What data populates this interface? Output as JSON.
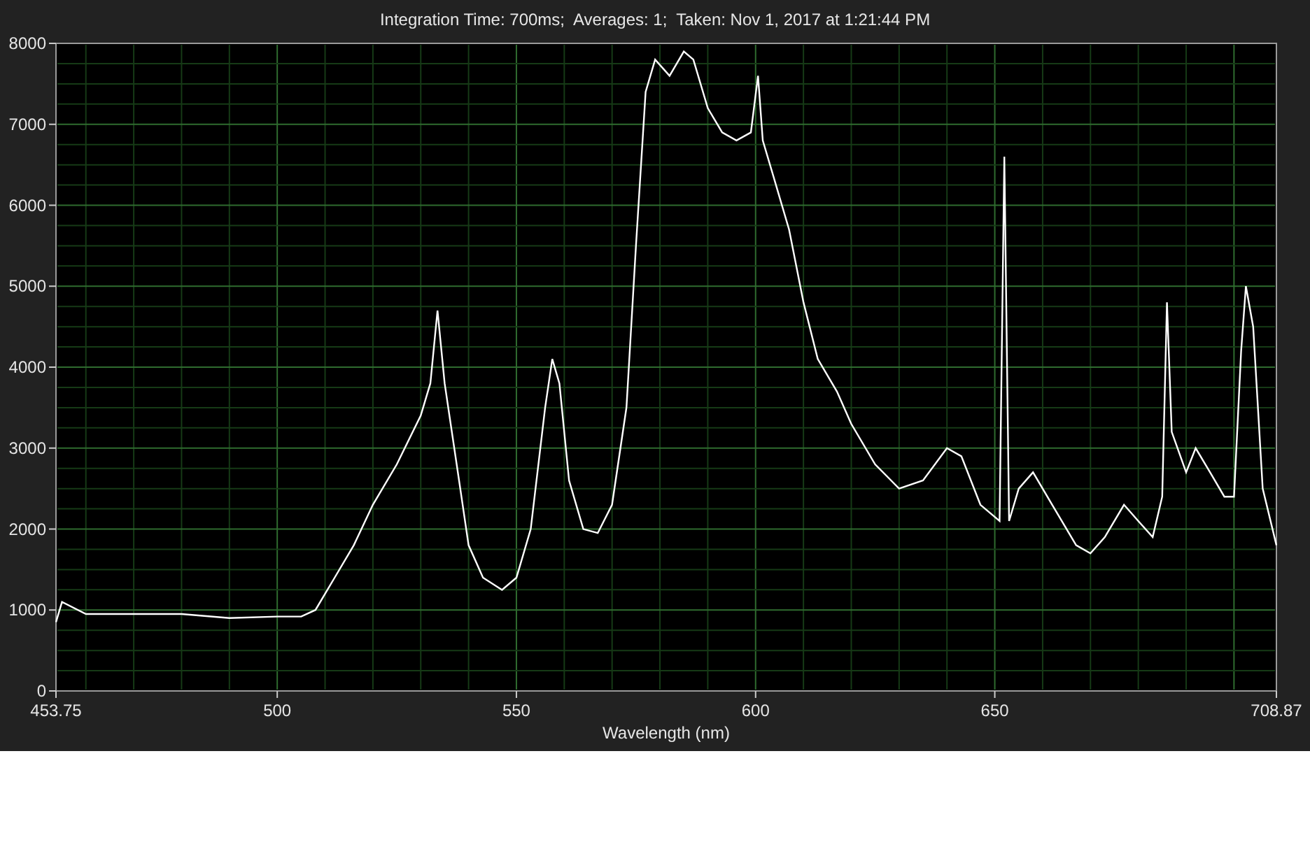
{
  "header": {
    "title": "Integration Time: 700ms;  Averages: 1;  Taken: Nov 1, 2017 at 1:21:44 PM"
  },
  "chart_data": {
    "type": "line",
    "xlabel": "Wavelength (nm)",
    "x": [
      453.75,
      455,
      460,
      470,
      480,
      490,
      500,
      505,
      508,
      512,
      516,
      520,
      525,
      530,
      532,
      533.5,
      535,
      538,
      540,
      543,
      547,
      550,
      553,
      556,
      557.5,
      559,
      561,
      564,
      567,
      570,
      573,
      575,
      577,
      579,
      582,
      585,
      587,
      590,
      593,
      596,
      599,
      600.5,
      601.5,
      604,
      607,
      610,
      613,
      617,
      620,
      625,
      630,
      635,
      640,
      643,
      647,
      651,
      652,
      653,
      655,
      658,
      662,
      667,
      670,
      673,
      677,
      680,
      683,
      685,
      686,
      687,
      690,
      692,
      695,
      698,
      700,
      701.5,
      702.5,
      704,
      706,
      708.87
    ],
    "grid": true,
    "series": [
      {
        "color": "#ffffff",
        "values": [
          850,
          1100,
          950,
          950,
          950,
          900,
          920,
          920,
          1000,
          1400,
          1800,
          2300,
          2800,
          3400,
          3800,
          4700,
          3800,
          2600,
          1800,
          1400,
          1250,
          1400,
          2000,
          3500,
          4100,
          3800,
          2600,
          2000,
          1950,
          2300,
          3500,
          5500,
          7400,
          7800,
          7600,
          7900,
          7800,
          7200,
          6900,
          6800,
          6900,
          7600,
          6800,
          6300,
          5700,
          4800,
          4100,
          3700,
          3300,
          2800,
          2500,
          2600,
          3000,
          2900,
          2300,
          2100,
          6600,
          2100,
          2500,
          2700,
          2300,
          1800,
          1700,
          1900,
          2300,
          2100,
          1900,
          2400,
          4800,
          3200,
          2700,
          3000,
          2700,
          2400,
          2400,
          4200,
          5000,
          4500,
          2500,
          1800
        ]
      }
    ],
    "xlim": [
      453.75,
      708.87
    ],
    "ylim": [
      0,
      8000
    ],
    "xticks": [
      {
        "value": 453.75,
        "label": "453.75"
      },
      {
        "value": 500,
        "label": "500"
      },
      {
        "value": 550,
        "label": "550"
      },
      {
        "value": 600,
        "label": "600"
      },
      {
        "value": 650,
        "label": "650"
      },
      {
        "value": 708.87,
        "label": "708.87"
      }
    ],
    "yticks": [
      {
        "value": 0,
        "label": "0"
      },
      {
        "value": 1000,
        "label": "1000"
      },
      {
        "value": 2000,
        "label": "2000"
      },
      {
        "value": 3000,
        "label": "3000"
      },
      {
        "value": 4000,
        "label": "4000"
      },
      {
        "value": 5000,
        "label": "5000"
      },
      {
        "value": 6000,
        "label": "6000"
      },
      {
        "value": 7000,
        "label": "7000"
      },
      {
        "value": 8000,
        "label": "8000"
      }
    ]
  }
}
